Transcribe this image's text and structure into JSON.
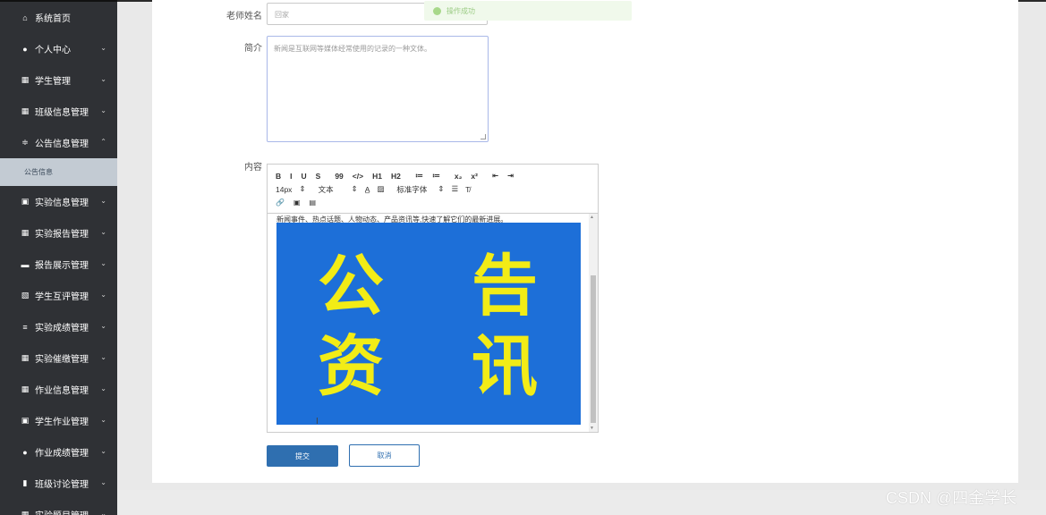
{
  "sidebar": {
    "items": [
      {
        "icon": "home-icon",
        "glyph": "⌂",
        "label": "系统首页",
        "chevron": ""
      },
      {
        "icon": "user-icon",
        "glyph": "●",
        "label": "个人中心",
        "chevron": "⌄"
      },
      {
        "icon": "grid-icon",
        "glyph": "▦",
        "label": "学生管理",
        "chevron": "⌄"
      },
      {
        "icon": "grid-icon",
        "glyph": "▦",
        "label": "班级信息管理",
        "chevron": "⌄"
      },
      {
        "icon": "sliders-icon",
        "glyph": "≑",
        "label": "公告信息管理",
        "chevron": "⌃"
      }
    ],
    "sub_item": "公告信息",
    "items_after": [
      {
        "icon": "clipboard-icon",
        "glyph": "▣",
        "label": "实验信息管理",
        "chevron": "⌄"
      },
      {
        "icon": "grid-icon",
        "glyph": "▦",
        "label": "实验报告管理",
        "chevron": "⌄"
      },
      {
        "icon": "monitor-icon",
        "glyph": "▬",
        "label": "报告展示管理",
        "chevron": "⌄"
      },
      {
        "icon": "chart-icon",
        "glyph": "▧",
        "label": "学生互评管理",
        "chevron": "⌄"
      },
      {
        "icon": "list-icon",
        "glyph": "≡",
        "label": "实验成绩管理",
        "chevron": "⌄"
      },
      {
        "icon": "grid-icon",
        "glyph": "▦",
        "label": "实验催缴管理",
        "chevron": "⌄"
      },
      {
        "icon": "grid-icon",
        "glyph": "▦",
        "label": "作业信息管理",
        "chevron": "⌄"
      },
      {
        "icon": "clipboard-icon",
        "glyph": "▣",
        "label": "学生作业管理",
        "chevron": "⌄"
      },
      {
        "icon": "user-icon",
        "glyph": "●",
        "label": "作业成绩管理",
        "chevron": "⌄"
      },
      {
        "icon": "bars-icon",
        "glyph": "▮",
        "label": "班级讨论管理",
        "chevron": "⌄"
      },
      {
        "icon": "grid-icon",
        "glyph": "▦",
        "label": "实验题目管理",
        "chevron": "⌄"
      }
    ]
  },
  "form": {
    "teacher_label": "老师姓名",
    "teacher_value": "回家",
    "intro_label": "简介",
    "intro_value": "新闻是互联网等媒体经常使用的记录的一种文体。",
    "content_label": "内容",
    "content_text": "新闻事件、热点话题、人物动态、产品资讯等,快速了解它们的最新进展。",
    "banner_chars": [
      "公",
      "告",
      "资",
      "讯"
    ]
  },
  "toolbar": {
    "row1": [
      "B",
      "I",
      "U",
      "S",
      "99",
      "</>",
      "H1",
      "H2",
      "≔",
      "≔",
      "x₂",
      "x²",
      "⇤",
      "⇥"
    ],
    "font_size": "14px",
    "format": "文本",
    "font_family": "标准字体",
    "row3": [
      "🔗",
      "▣",
      "▤"
    ]
  },
  "toast": {
    "message": "操作成功"
  },
  "buttons": {
    "submit": "提交",
    "cancel": "取消"
  },
  "watermark": "CSDN @四金学长",
  "colors": {
    "sidebar_bg": "#2f3135",
    "primary": "#2f6fb0",
    "banner_bg": "#1d6fd8",
    "banner_text": "#f2ec16"
  }
}
